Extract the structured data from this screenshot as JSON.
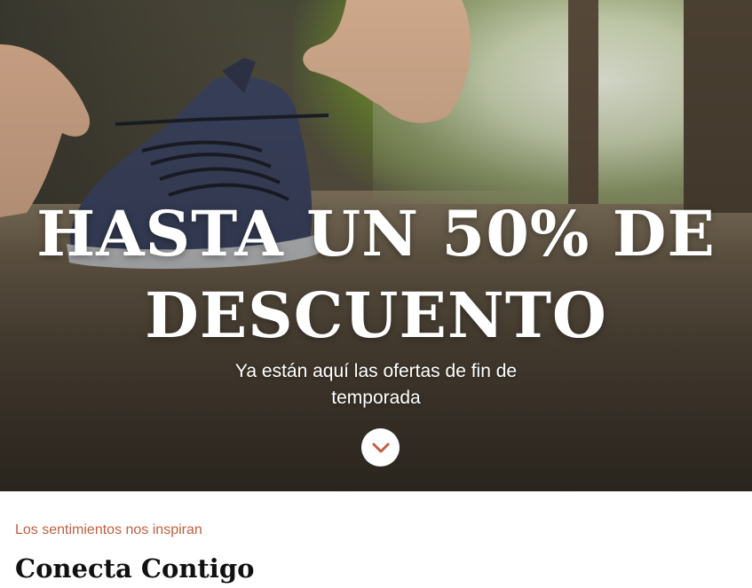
{
  "hero": {
    "title": "HASTA UN 50% DE DESCUENTO",
    "subtitle": "Ya están aquí las ofertas de fin de temporada",
    "scroll_icon": "chevron-down-icon",
    "image_subject": "person-tying-running-shoe"
  },
  "section": {
    "eyebrow": "Los sentimientos nos inspiran",
    "title": "Conecta Contigo"
  },
  "colors": {
    "accent": "#c0603e",
    "hero_text": "#ffffff",
    "heading": "#111111",
    "scroll_button_bg": "#ffffff"
  }
}
